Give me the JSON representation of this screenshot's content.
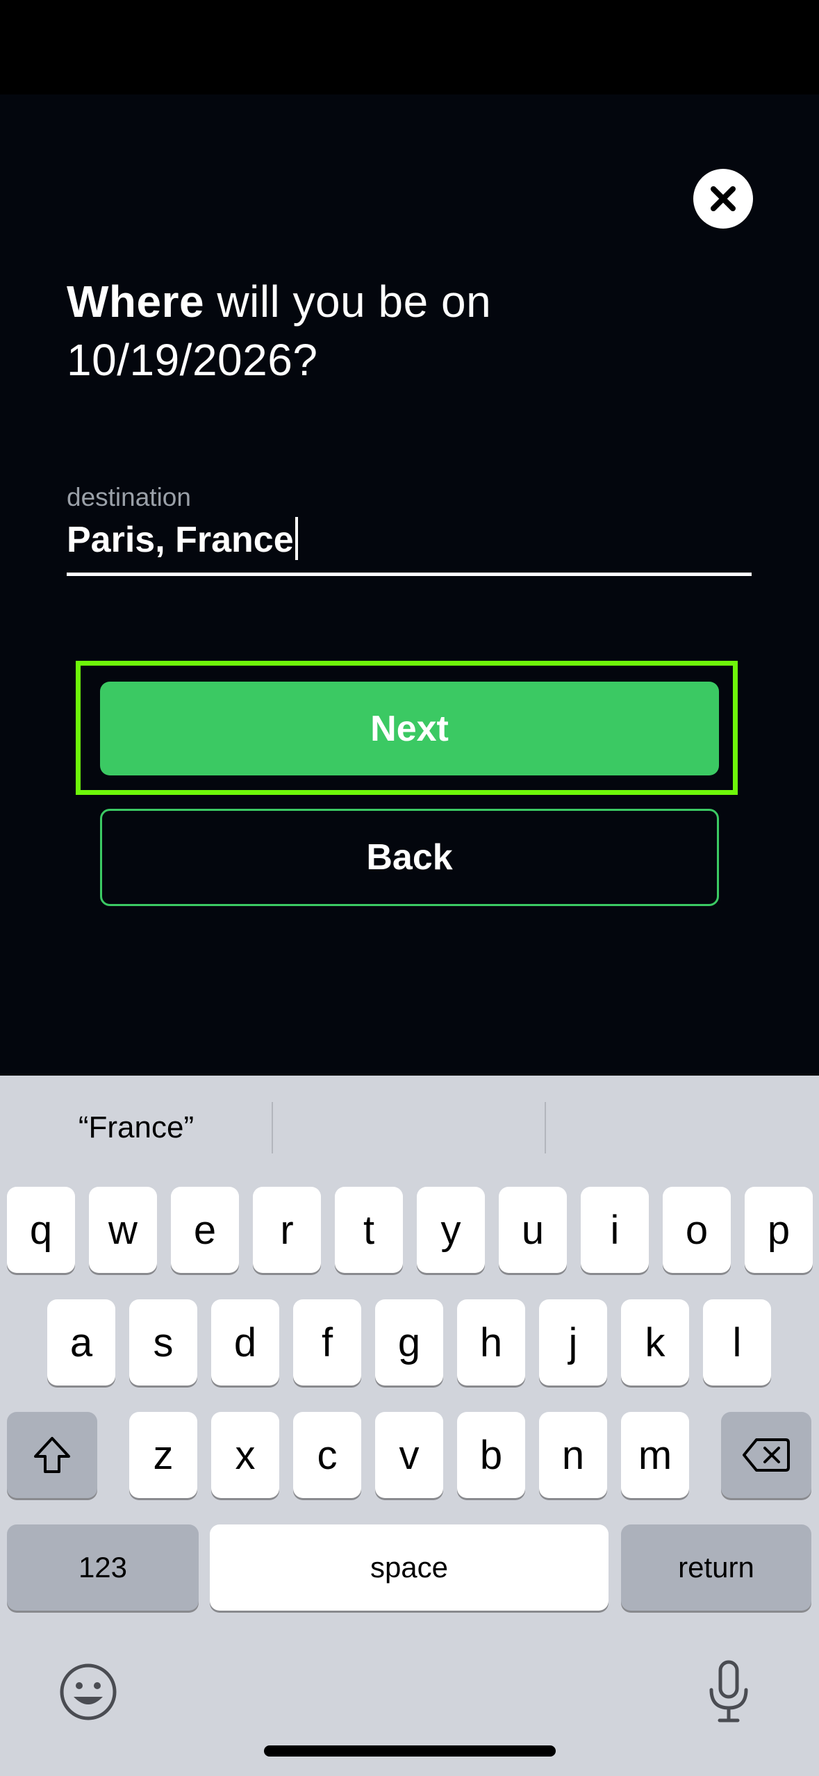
{
  "form": {
    "question_strong": "Where",
    "question_rest": " will you be on",
    "question_date": "10/19/2026?",
    "destination_label": "destination",
    "destination_value": "Paris, France"
  },
  "buttons": {
    "next": "Next",
    "back": "Back"
  },
  "keyboard": {
    "suggestions": [
      "“France”",
      "",
      ""
    ],
    "row1": [
      "q",
      "w",
      "e",
      "r",
      "t",
      "y",
      "u",
      "i",
      "o",
      "p"
    ],
    "row2": [
      "a",
      "s",
      "d",
      "f",
      "g",
      "h",
      "j",
      "k",
      "l"
    ],
    "row3": [
      "z",
      "x",
      "c",
      "v",
      "b",
      "n",
      "m"
    ],
    "numbers_key": "123",
    "space_key": "space",
    "return_key": "return"
  },
  "colors": {
    "background": "#03060d",
    "accent_green": "#3bc963",
    "highlight": "#6ef70a",
    "keyboard_bg": "#d1d4db"
  },
  "icons": [
    "close-icon",
    "shift-icon",
    "delete-icon",
    "emoji-icon",
    "microphone-icon"
  ]
}
